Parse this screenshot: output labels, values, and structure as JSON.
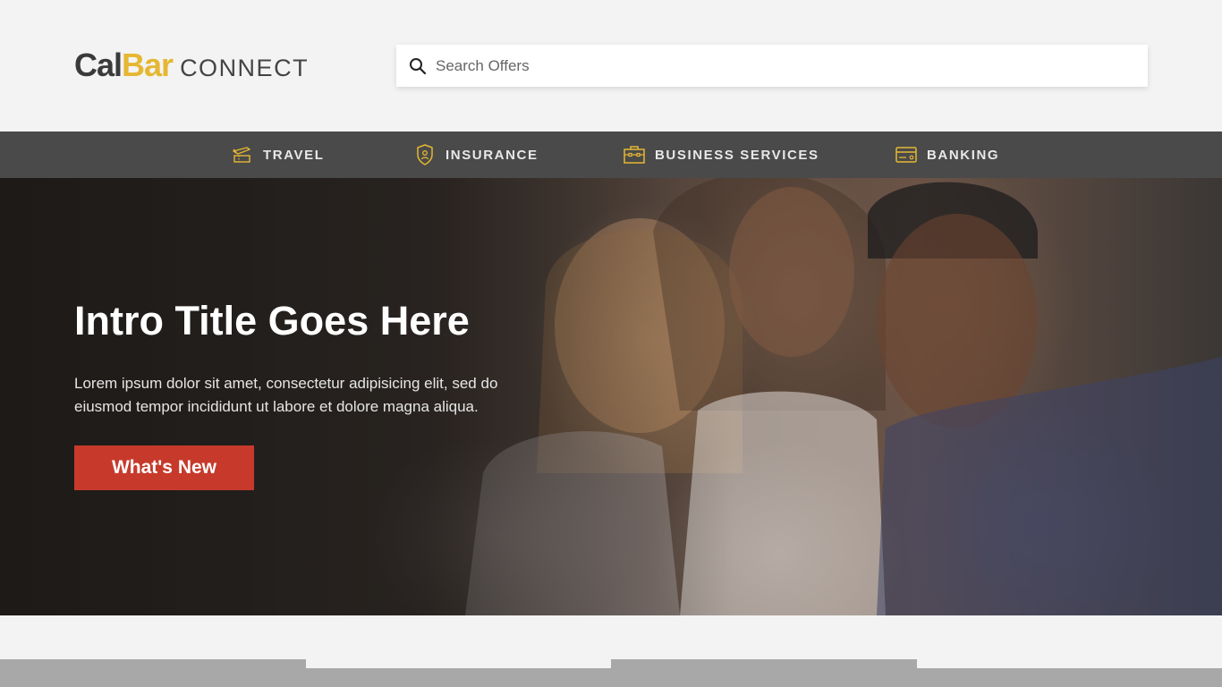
{
  "brand": {
    "logo_part1": "Cal",
    "logo_part2": "Bar",
    "logo_part3": "CONNECT",
    "accent_color": "#e5b732"
  },
  "search": {
    "placeholder": "Search Offers",
    "value": "",
    "icon": "search-icon"
  },
  "nav": {
    "items": [
      {
        "label": "TRAVEL",
        "icon": "airplane-ticket-icon"
      },
      {
        "label": "INSURANCE",
        "icon": "shield-icon"
      },
      {
        "label": "BUSINESS SERVICES",
        "icon": "briefcase-icon"
      },
      {
        "label": "BANKING",
        "icon": "credit-card-icon"
      }
    ],
    "background": "#4a4a4a",
    "icon_color": "#e5b732"
  },
  "hero": {
    "title": "Intro Title Goes Here",
    "text": "Lorem ipsum dolor sit amet, consectetur adipisicing elit, sed do eiusmod tempor incididunt ut labore et dolore magna aliqua.",
    "button_label": "What's New",
    "button_color": "#c73a2b"
  }
}
